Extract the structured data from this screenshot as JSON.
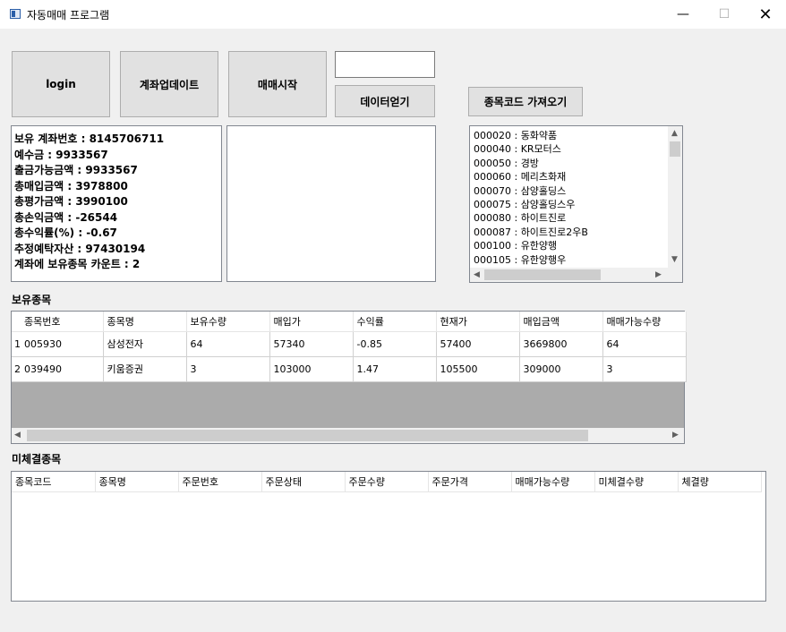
{
  "window": {
    "title": "자동매매 프로그램",
    "minimize": "—",
    "maximize": "☐",
    "close": "✕"
  },
  "buttons": {
    "login": "login",
    "account_update": "계좌업데이트",
    "start_trading": "매매시작",
    "get_data": "데이터얻기",
    "get_stock_codes": "종목코드 가져오기"
  },
  "data_input": {
    "value": ""
  },
  "account_info": [
    "보유 계좌번호 : 8145706711",
    "예수금 : 9933567",
    "출금가능금액 : 9933567",
    "총매입금액 : 3978800",
    "총평가금액 : 3990100",
    "총손익금액 : -26544",
    "총수익률(%) : -0.67",
    "추정예탁자산 : 97430194",
    "계좌에 보유종목 카운트 : 2"
  ],
  "stock_codes": [
    "000020 : 동화약품",
    "000040 : KR모터스",
    "000050 : 경방",
    "000060 : 메리츠화재",
    "000070 : 삼양홀딩스",
    "000075 : 삼양홀딩스우",
    "000080 : 하이트진로",
    "000087 : 하이트진로2우B",
    "000100 : 유한양행",
    "000105 : 유한양행우"
  ],
  "holdings": {
    "label": "보유종목",
    "columns": [
      "종목번호",
      "종목명",
      "보유수량",
      "매입가",
      "수익률",
      "현재가",
      "매입금액",
      "매매가능수량"
    ],
    "rows": [
      {
        "index": "1",
        "cells": [
          "005930",
          "삼성전자",
          "64",
          "57340",
          "-0.85",
          "57400",
          "3669800",
          "64"
        ]
      },
      {
        "index": "2",
        "cells": [
          "039490",
          "키움증권",
          "3",
          "103000",
          "1.47",
          "105500",
          "309000",
          "3"
        ]
      }
    ]
  },
  "unfilled": {
    "label": "미체결종목",
    "columns": [
      "종목코드",
      "종목명",
      "주문번호",
      "주문상태",
      "주문수량",
      "주문가격",
      "매매가능수량",
      "미체결수량",
      "체결량"
    ]
  },
  "scroll_arrows": {
    "up": "▲",
    "down": "▼",
    "left": "◀",
    "right": "▶"
  }
}
